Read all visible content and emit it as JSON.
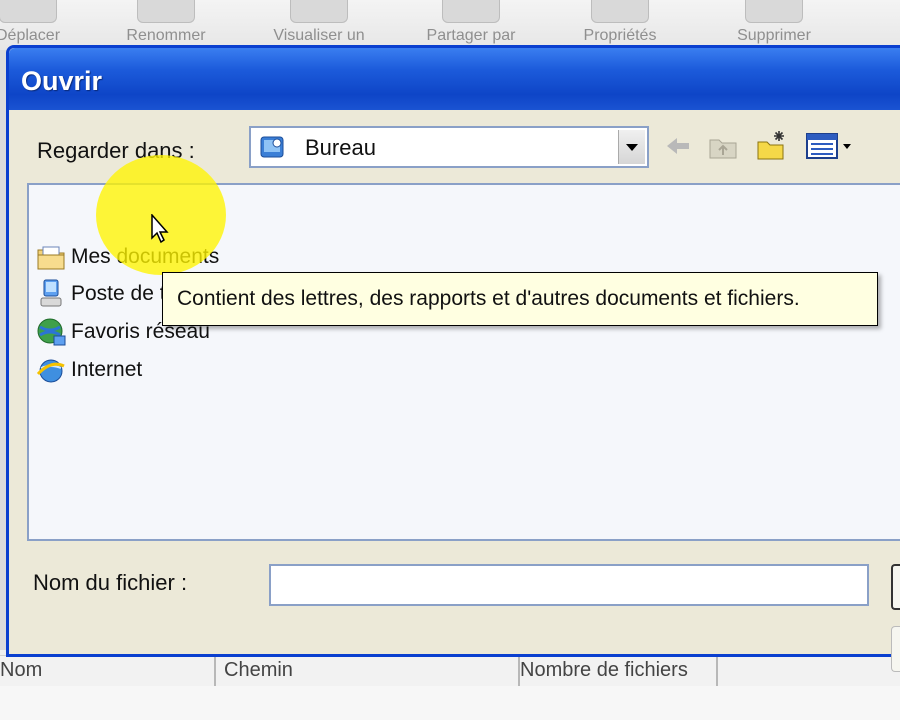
{
  "background_toolbar": {
    "items": [
      {
        "label": "Déplacer"
      },
      {
        "label": "Renommer"
      },
      {
        "label": "Visualiser un"
      },
      {
        "label": "Partager par"
      },
      {
        "label": "Propriétés"
      },
      {
        "label": "Supprimer"
      }
    ]
  },
  "background_list": {
    "columns": [
      "Nom",
      "Chemin",
      "Nombre de fichiers"
    ]
  },
  "dialog": {
    "title": "Ouvrir",
    "look_in_label": "Regarder dans :",
    "look_in_value": "Bureau",
    "file_name_label": "Nom du fichier :",
    "file_name_value": "",
    "items": [
      {
        "name": "Mes documents",
        "icon": "my-documents-icon"
      },
      {
        "name": "Poste de travail",
        "icon": "my-computer-icon"
      },
      {
        "name": "Favoris réseau",
        "icon": "network-places-icon"
      },
      {
        "name": "Internet",
        "icon": "internet-icon"
      }
    ],
    "tooltip": "Contient des lettres, des rapports et d'autres documents et fichiers."
  },
  "colors": {
    "title_bar": "#0e45c7",
    "dialog_bg": "#ece9d8",
    "tooltip_bg": "#ffffe1",
    "highlight": "#fff500"
  }
}
